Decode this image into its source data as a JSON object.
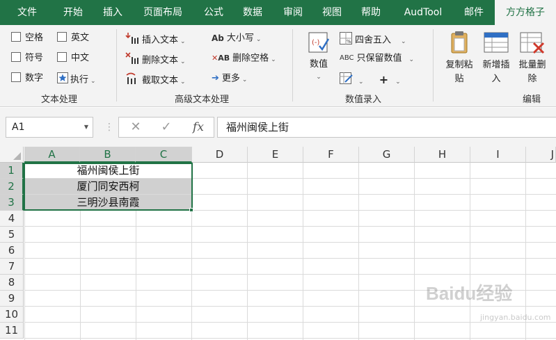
{
  "ribbon_tabs": [
    {
      "label": "文件"
    },
    {
      "label": "开始"
    },
    {
      "label": "插入"
    },
    {
      "label": "页面布局"
    },
    {
      "label": "公式"
    },
    {
      "label": "数据"
    },
    {
      "label": "审阅"
    },
    {
      "label": "视图"
    },
    {
      "label": "帮助"
    },
    {
      "label": "AudTool"
    },
    {
      "label": "邮件"
    },
    {
      "label": "方方格子",
      "active": true
    }
  ],
  "ribbon": {
    "text_processing": {
      "items": [
        "空格",
        "英文",
        "符号",
        "中文",
        "数字",
        "执行"
      ],
      "label": "文本处理"
    },
    "advanced_text": {
      "insert_text": "插入文本",
      "delete_text": "删除文本",
      "extract_text": "截取文本",
      "case": "大小写",
      "delete_spaces": "删除空格",
      "more": "更多",
      "label": "高级文本处理"
    },
    "number_entry": {
      "value_button": "数值",
      "round": "四舍五入",
      "keep_values": "只保留数值",
      "label": "数值录入"
    },
    "edit": {
      "copy_paste": "复制粘\n贴",
      "add_insert": "新增插\n入",
      "batch_delete": "批量删\n除",
      "label": "编辑"
    }
  },
  "formula_bar": {
    "name_box": "A1",
    "cancel_symbol": "✕",
    "enter_symbol": "✓",
    "fx_label": "fx",
    "content": "福州闽侯上街"
  },
  "columns": [
    "A",
    "B",
    "C",
    "D",
    "E",
    "F",
    "G",
    "H",
    "I",
    "J"
  ],
  "rows": [
    "1",
    "2",
    "3",
    "4",
    "5",
    "6",
    "7",
    "8",
    "9",
    "10",
    "11"
  ],
  "cells": {
    "r1": "福州闽侯上街",
    "r2": "厦门同安西柯",
    "r3": "三明沙县南霞"
  },
  "watermark": {
    "main": "Baidu经验",
    "sub": "jingyan.baidu.com"
  },
  "colors": {
    "accent": "#217346",
    "selection_fill": "#d0d0d0"
  }
}
